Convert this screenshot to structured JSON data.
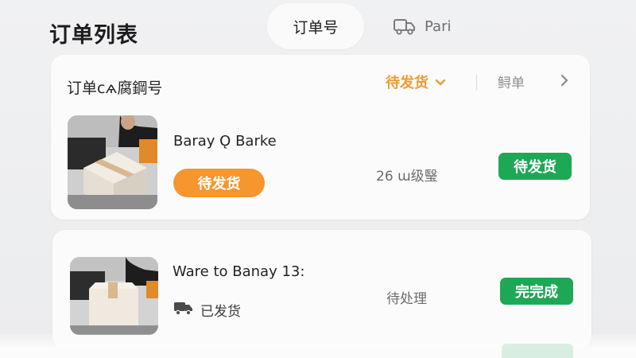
{
  "header": {
    "title": "订单列表",
    "tabs": [
      {
        "label": "订单号",
        "active": true
      },
      {
        "label": "Pari",
        "icon": "truck-icon",
        "active": false
      }
    ]
  },
  "orders": [
    {
      "header_label": "订单сѧ腐鋼号",
      "status_filter": "待发货",
      "link": "鲟单",
      "title": "Baray Ǫ Barke",
      "status_pill": "待发货",
      "middle_text": "26 ɯ级瑿",
      "badge": "待发货",
      "thumb": "package-photo"
    },
    {
      "title": "Ware to Banay 13:",
      "shipping_icon": "truck-icon",
      "shipping_text": "已发货",
      "middle_text": "待处理",
      "badge": "完完成",
      "thumb": "package-photo"
    }
  ],
  "colors": {
    "orange": "#f5962e",
    "orange_text": "#ef9b35",
    "green": "#1ea856",
    "background": "#eeeff1"
  }
}
